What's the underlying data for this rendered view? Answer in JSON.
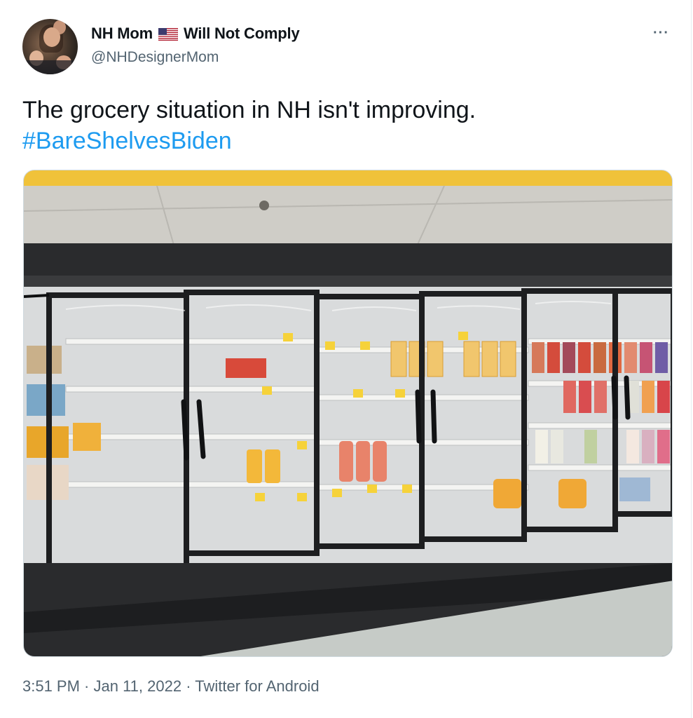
{
  "tweet": {
    "display_name": "NH Mom",
    "display_name_suffix": "Will Not Comply",
    "handle": "@NHDesignerMom",
    "text_line1": "The grocery situation in NH isn't improving.",
    "hashtag": "#BareShelvesBiden",
    "time": "3:51 PM",
    "date": "Jan 11, 2022",
    "source": "Twitter for Android",
    "sep": " · ",
    "more_label": "···"
  },
  "icons": {
    "flag": "us-flag-icon",
    "more": "more-options-icon"
  },
  "colors": {
    "link": "#1d9bf0",
    "secondary_text": "#536471",
    "ceiling_trim": "#f0c23a"
  }
}
